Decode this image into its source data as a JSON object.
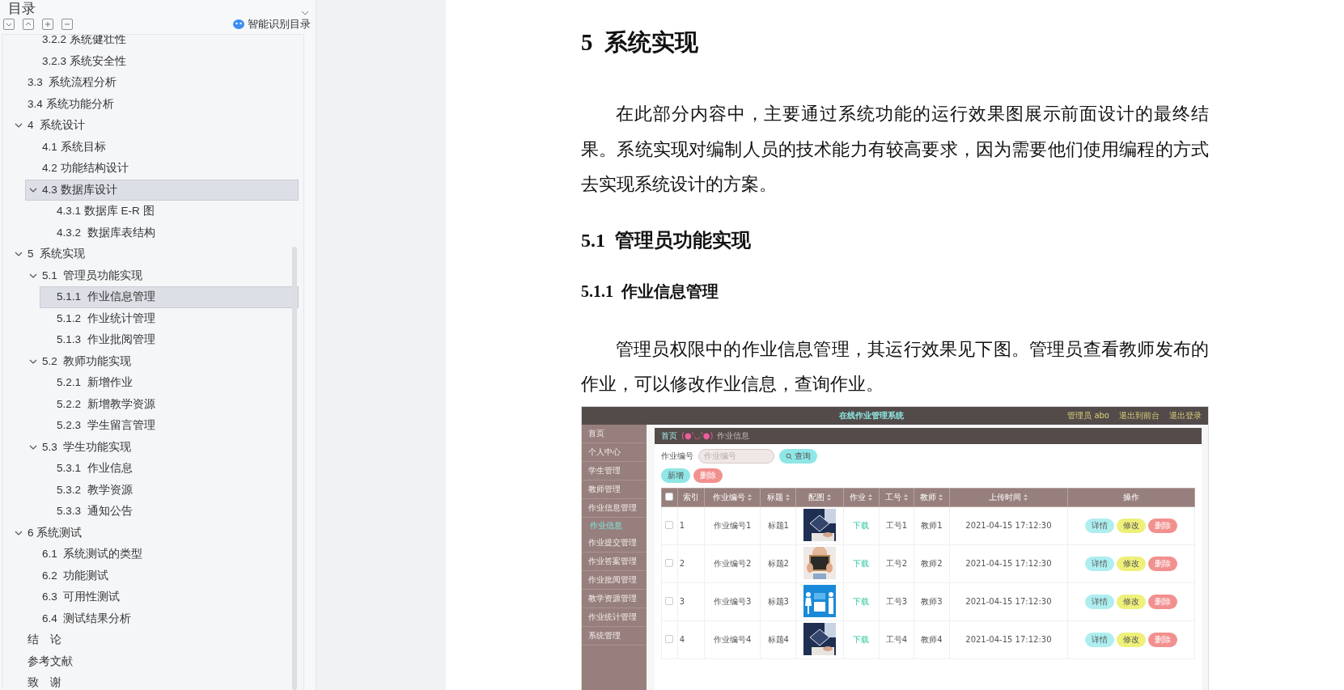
{
  "toc": {
    "title": "目录",
    "smart_button": "智能识别目录",
    "items": [
      {
        "children": [
          {
            "children": [
              {
                "label": "3.2.2 系统健壮性",
                "selected": false
              },
              {
                "label": "3.2.3 系统安全性",
                "selected": false
              }
            ]
          },
          {
            "label": "3.3  系统流程分析",
            "selected": false
          },
          {
            "label": "3.4 系统功能分析",
            "selected": false
          }
        ]
      },
      {
        "label": "4  系统设计",
        "selected": false,
        "expanded": true,
        "children": [
          {
            "label": "4.1 系统目标",
            "selected": false
          },
          {
            "label": "4.2 功能结构设计",
            "selected": false
          },
          {
            "label": "4.3 数据库设计",
            "selected": true,
            "expanded": true,
            "children": [
              {
                "label": "4.3.1 数据库 E-R 图",
                "selected": false
              },
              {
                "label": "4.3.2  数据库表结构",
                "selected": false
              }
            ]
          }
        ]
      },
      {
        "label": "5  系统实现",
        "selected": false,
        "expanded": true,
        "children": [
          {
            "label": "5.1  管理员功能实现",
            "selected": false,
            "expanded": true,
            "children": [
              {
                "label": "5.1.1  作业信息管理",
                "selected": true
              },
              {
                "label": "5.1.2  作业统计管理",
                "selected": false
              },
              {
                "label": "5.1.3  作业批阅管理",
                "selected": false
              }
            ]
          },
          {
            "label": "5.2  教师功能实现",
            "selected": false,
            "expanded": true,
            "children": [
              {
                "label": "5.2.1  新增作业",
                "selected": false
              },
              {
                "label": "5.2.2  新增教学资源",
                "selected": false
              },
              {
                "label": "5.2.3  学生留言管理",
                "selected": false
              }
            ]
          },
          {
            "label": "5.3  学生功能实现",
            "selected": false,
            "expanded": true,
            "children": [
              {
                "label": "5.3.1  作业信息",
                "selected": false
              },
              {
                "label": "5.3.2  教学资源",
                "selected": false
              },
              {
                "label": "5.3.3  通知公告",
                "selected": false
              }
            ]
          }
        ]
      },
      {
        "label": "6 系统测试",
        "selected": false,
        "expanded": true,
        "children": [
          {
            "label": "6.1  系统测试的类型",
            "selected": false
          },
          {
            "label": "6.2  功能测试",
            "selected": false
          },
          {
            "label": "6.3  可用性测试",
            "selected": false
          },
          {
            "label": "6.4  测试结果分析",
            "selected": false
          }
        ]
      },
      {
        "label": "结　论",
        "selected": false
      },
      {
        "label": "参考文献",
        "selected": false
      },
      {
        "label": "致　谢",
        "selected": false
      }
    ]
  },
  "document": {
    "blocks": [
      {
        "kind": "heading1",
        "text": "5  系统实现"
      },
      {
        "kind": "paragraph",
        "text": "在此部分内容中，主要通过系统功能的运行效果图展示前面设计的最终结果。系统实现对编制人员的技术能力有较高要求，因为需要他们使用编程的方式去实现系统设计的方案。"
      },
      {
        "kind": "heading2",
        "text": "5.1  管理员功能实现"
      },
      {
        "kind": "heading3",
        "text": "5.1.1  作业信息管理"
      },
      {
        "kind": "paragraph",
        "text": "管理员权限中的作业信息管理，其运行效果见下图。管理员查看教师发布的作业，可以修改作业信息，查询作业。"
      },
      {
        "kind": "figure",
        "app": {
          "title": "在线作业管理系统",
          "user": "管理员 abo",
          "links": [
            "退出到前台",
            "退出登录"
          ],
          "menu": [
            {
              "label": "首页",
              "kind": "group",
              "selected": false
            },
            {
              "label": "个人中心",
              "kind": "group",
              "selected": false
            },
            {
              "label": "学生管理",
              "kind": "group",
              "selected": false
            },
            {
              "label": "教师管理",
              "kind": "group",
              "selected": false
            },
            {
              "label": "作业信息管理",
              "kind": "group",
              "selected": false
            },
            {
              "label": "作业信息",
              "kind": "sub",
              "selected": true
            },
            {
              "label": "作业提交管理",
              "kind": "group",
              "selected": false
            },
            {
              "label": "作业答案管理",
              "kind": "group",
              "selected": false
            },
            {
              "label": "作业批阅管理",
              "kind": "group",
              "selected": false
            },
            {
              "label": "教学资源管理",
              "kind": "group",
              "selected": false
            },
            {
              "label": "作业统计管理",
              "kind": "group",
              "selected": false
            },
            {
              "label": "系统管理",
              "kind": "group",
              "selected": false
            }
          ],
          "breadcrumb": {
            "home": "首页",
            "emoticon": "(●'◡'●)",
            "current": "作业信息"
          },
          "search": {
            "label": "作业编号",
            "placeholder": "作业编号",
            "button": "查询"
          },
          "actions": [
            {
              "label": "新增",
              "kind": "add"
            },
            {
              "label": "删除",
              "kind": "delete"
            }
          ],
          "select_all_checked": false,
          "columns": [
            {
              "label": "索引",
              "sortable": false
            },
            {
              "label": "作业编号",
              "sortable": true
            },
            {
              "label": "标题",
              "sortable": true
            },
            {
              "label": "配图",
              "sortable": true
            },
            {
              "label": "作业",
              "sortable": true
            },
            {
              "label": "工号",
              "sortable": true
            },
            {
              "label": "教师",
              "sortable": true
            },
            {
              "label": "上传时间",
              "sortable": true
            },
            {
              "label": "操作",
              "sortable": false
            }
          ],
          "rows": [
            {
              "checked": false,
              "index": "1",
              "code": "作业编号1",
              "title": "标题1",
              "file": "下载",
              "staff_no": "工号1",
              "teacher": "教师1",
              "time": "2021-04-15 17:12:30",
              "ops": [
                {
                  "label": "详情",
                  "kind": "detail"
                },
                {
                  "label": "修改",
                  "kind": "edit"
                },
                {
                  "label": "删除",
                  "kind": "delete"
                }
              ]
            },
            {
              "checked": false,
              "index": "2",
              "code": "作业编号2",
              "title": "标题2",
              "file": "下载",
              "staff_no": "工号2",
              "teacher": "教师2",
              "time": "2021-04-15 17:12:30",
              "ops": [
                {
                  "label": "详情",
                  "kind": "detail"
                },
                {
                  "label": "修改",
                  "kind": "edit"
                },
                {
                  "label": "删除",
                  "kind": "delete"
                }
              ]
            },
            {
              "checked": false,
              "index": "3",
              "code": "作业编号3",
              "title": "标题3",
              "file": "下载",
              "staff_no": "工号3",
              "teacher": "教师3",
              "time": "2021-04-15 17:12:30",
              "ops": [
                {
                  "label": "详情",
                  "kind": "detail"
                },
                {
                  "label": "修改",
                  "kind": "edit"
                },
                {
                  "label": "删除",
                  "kind": "delete"
                }
              ]
            },
            {
              "checked": false,
              "index": "4",
              "code": "作业编号4",
              "title": "标题4",
              "file": "下载",
              "staff_no": "工号4",
              "teacher": "教师4",
              "time": "2021-04-15 17:12:30",
              "ops": [
                {
                  "label": "详情",
                  "kind": "detail"
                },
                {
                  "label": "修改",
                  "kind": "edit"
                },
                {
                  "label": "删除",
                  "kind": "delete"
                }
              ]
            }
          ]
        }
      }
    ]
  }
}
